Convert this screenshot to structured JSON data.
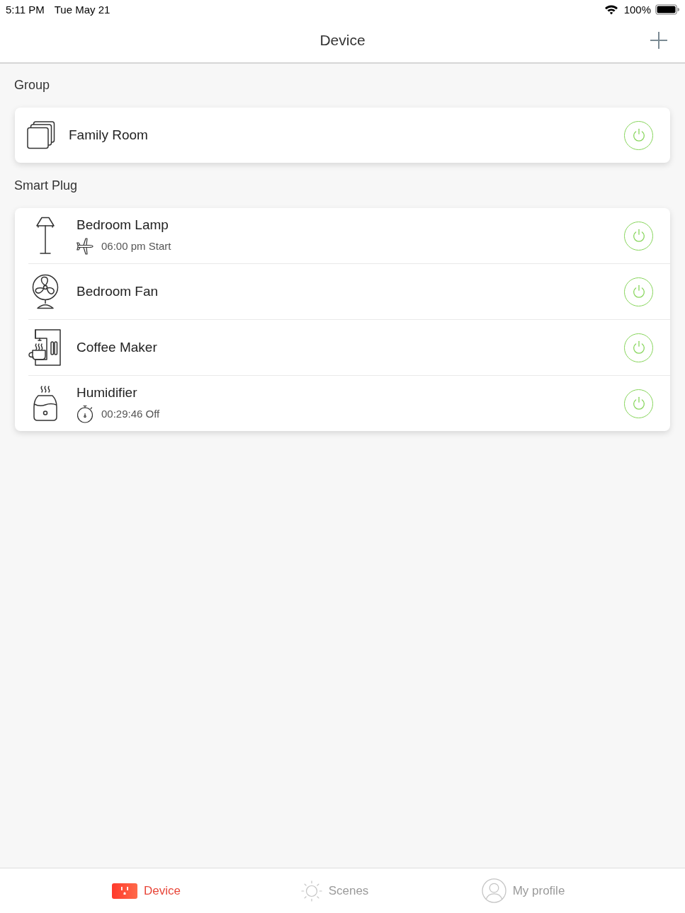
{
  "status_bar": {
    "time": "5:11 PM",
    "date": "Tue May 21",
    "battery": "100%"
  },
  "nav": {
    "title": "Device"
  },
  "sections": [
    {
      "title": "Group",
      "items": [
        {
          "kind": "group",
          "name": "Family Room",
          "on": true
        }
      ]
    },
    {
      "title": "Smart Plug",
      "items": [
        {
          "kind": "lamp",
          "name": "Bedroom Lamp",
          "status": {
            "kind": "away",
            "text": "06:00 pm Start"
          },
          "on": true
        },
        {
          "kind": "fan",
          "name": "Bedroom Fan",
          "on": true
        },
        {
          "kind": "coffee_maker",
          "name": "Coffee Maker",
          "on": true
        },
        {
          "kind": "humidifier",
          "name": "Humidifier",
          "status": {
            "kind": "timer",
            "text": "00:29:46 Off"
          },
          "on": true
        }
      ]
    }
  ],
  "tabs": [
    {
      "kind": "device",
      "label": "Device",
      "selected": true
    },
    {
      "kind": "scenes",
      "label": "Scenes",
      "selected": false
    },
    {
      "kind": "profile",
      "label": "My profile",
      "selected": false
    }
  ]
}
